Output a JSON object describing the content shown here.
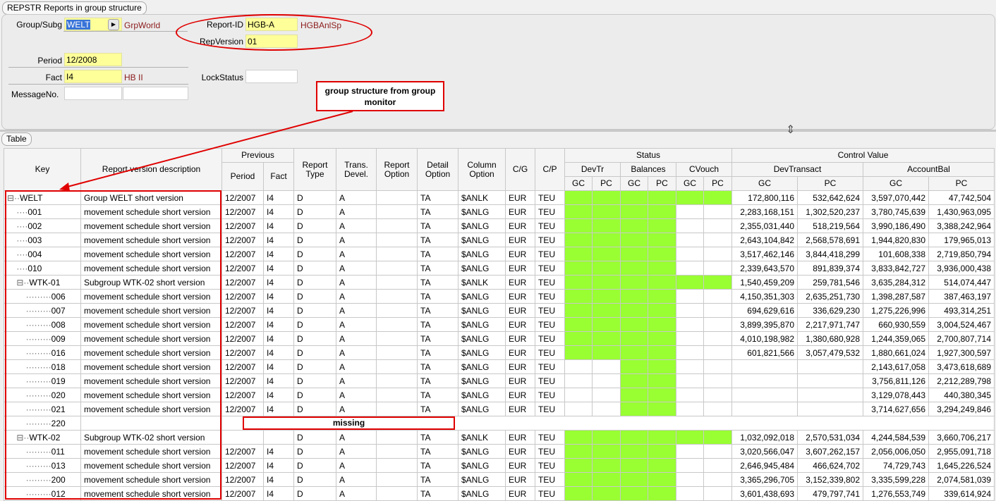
{
  "window": {
    "title": "REPSTR Reports in group structure"
  },
  "form": {
    "group_subg": {
      "label": "Group/Subg",
      "value": "WELT",
      "desc": "GrpWorld"
    },
    "report_id": {
      "label": "Report-ID",
      "value": "HGB-A",
      "desc": "HGBAnlSp"
    },
    "rep_version": {
      "label": "RepVersion",
      "value": "01"
    },
    "period": {
      "label": "Period",
      "value": "12/2008"
    },
    "fact": {
      "label": "Fact",
      "value": "I4",
      "desc": "HB II"
    },
    "lock_status": {
      "label": "LockStatus",
      "value": ""
    },
    "message_no": {
      "label": "MessageNo.",
      "value": ""
    }
  },
  "table_tab": "Table",
  "annotations": {
    "callout": "group structure from group monitor",
    "missing": "missing"
  },
  "headers": {
    "key": "Key",
    "desc": "Report version description",
    "previous": "Previous",
    "period": "Period",
    "fact": "Fact",
    "report_type": "Report Type",
    "trans_devel": "Trans. Devel.",
    "report_option": "Report Option",
    "detail_option": "Detail Option",
    "column_option": "Column Option",
    "cg": "C/G",
    "cp": "C/P",
    "status": "Status",
    "devtr": "DevTr",
    "balances": "Balances",
    "cvouch": "CVouch",
    "control_value": "Control Value",
    "devtransact": "DevTransact",
    "accountbal": "AccountBal",
    "gc": "GC",
    "pc": "PC"
  },
  "rows": [
    {
      "key": "WELT",
      "prefix": "⊟··",
      "desc": "Group WELT short version",
      "period": "12/2007",
      "fact": "I4",
      "rtype": "D",
      "trans": "A",
      "ropt": "",
      "detail": "TA",
      "col": "$ANLK",
      "cg": "EUR",
      "cp": "TEU",
      "st": [
        1,
        1,
        1,
        1,
        1,
        1
      ],
      "dt_gc": "172,800,116",
      "dt_pc": "532,642,624",
      "ab_gc": "3,597,070,442",
      "ab_pc": "47,742,504"
    },
    {
      "key": "001",
      "prefix": "    ····",
      "desc": "movement schedule short version",
      "period": "12/2007",
      "fact": "I4",
      "rtype": "D",
      "trans": "A",
      "ropt": "",
      "detail": "TA",
      "col": "$ANLG",
      "cg": "EUR",
      "cp": "TEU",
      "st": [
        1,
        1,
        1,
        1,
        0,
        0
      ],
      "dt_gc": "2,283,168,151",
      "dt_pc": "1,302,520,237",
      "ab_gc": "3,780,745,639",
      "ab_pc": "1,430,963,095"
    },
    {
      "key": "002",
      "prefix": "    ····",
      "desc": "movement schedule short version",
      "period": "12/2007",
      "fact": "I4",
      "rtype": "D",
      "trans": "A",
      "ropt": "",
      "detail": "TA",
      "col": "$ANLG",
      "cg": "EUR",
      "cp": "TEU",
      "st": [
        1,
        1,
        1,
        1,
        0,
        0
      ],
      "dt_gc": "2,355,031,440",
      "dt_pc": "518,219,564",
      "ab_gc": "3,990,186,490",
      "ab_pc": "3,388,242,964"
    },
    {
      "key": "003",
      "prefix": "    ····",
      "desc": "movement schedule short version",
      "period": "12/2007",
      "fact": "I4",
      "rtype": "D",
      "trans": "A",
      "ropt": "",
      "detail": "TA",
      "col": "$ANLG",
      "cg": "EUR",
      "cp": "TEU",
      "st": [
        1,
        1,
        1,
        1,
        0,
        0
      ],
      "dt_gc": "2,643,104,842",
      "dt_pc": "2,568,578,691",
      "ab_gc": "1,944,820,830",
      "ab_pc": "179,965,013"
    },
    {
      "key": "004",
      "prefix": "    ····",
      "desc": "movement schedule short version",
      "period": "12/2007",
      "fact": "I4",
      "rtype": "D",
      "trans": "A",
      "ropt": "",
      "detail": "TA",
      "col": "$ANLG",
      "cg": "EUR",
      "cp": "TEU",
      "st": [
        1,
        1,
        1,
        1,
        0,
        0
      ],
      "dt_gc": "3,517,462,146",
      "dt_pc": "3,844,418,299",
      "ab_gc": "101,608,338",
      "ab_pc": "2,719,850,794"
    },
    {
      "key": "010",
      "prefix": "    ····",
      "desc": "movement schedule short version",
      "period": "12/2007",
      "fact": "I4",
      "rtype": "D",
      "trans": "A",
      "ropt": "",
      "detail": "TA",
      "col": "$ANLG",
      "cg": "EUR",
      "cp": "TEU",
      "st": [
        1,
        1,
        1,
        1,
        0,
        0
      ],
      "dt_gc": "2,339,643,570",
      "dt_pc": "891,839,374",
      "ab_gc": "3,833,842,727",
      "ab_pc": "3,936,000,438"
    },
    {
      "key": "WTK-01",
      "prefix": "    ⊟··",
      "desc": "Subgroup WTK-02 short version",
      "period": "12/2007",
      "fact": "I4",
      "rtype": "D",
      "trans": "A",
      "ropt": "",
      "detail": "TA",
      "col": "$ANLK",
      "cg": "EUR",
      "cp": "TEU",
      "st": [
        1,
        1,
        1,
        1,
        1,
        1
      ],
      "dt_gc": "1,540,459,209",
      "dt_pc": "259,781,546",
      "ab_gc": "3,635,284,312",
      "ab_pc": "514,074,447"
    },
    {
      "key": "006",
      "prefix": "        ·········",
      "desc": "movement schedule short version",
      "period": "12/2007",
      "fact": "I4",
      "rtype": "D",
      "trans": "A",
      "ropt": "",
      "detail": "TA",
      "col": "$ANLG",
      "cg": "EUR",
      "cp": "TEU",
      "st": [
        1,
        1,
        1,
        1,
        0,
        0
      ],
      "dt_gc": "4,150,351,303",
      "dt_pc": "2,635,251,730",
      "ab_gc": "1,398,287,587",
      "ab_pc": "387,463,197"
    },
    {
      "key": "007",
      "prefix": "        ·········",
      "desc": "movement schedule short version",
      "period": "12/2007",
      "fact": "I4",
      "rtype": "D",
      "trans": "A",
      "ropt": "",
      "detail": "TA",
      "col": "$ANLG",
      "cg": "EUR",
      "cp": "TEU",
      "st": [
        1,
        1,
        1,
        1,
        0,
        0
      ],
      "dt_gc": "694,629,616",
      "dt_pc": "336,629,230",
      "ab_gc": "1,275,226,996",
      "ab_pc": "493,314,251"
    },
    {
      "key": "008",
      "prefix": "        ·········",
      "desc": "movement schedule short version",
      "period": "12/2007",
      "fact": "I4",
      "rtype": "D",
      "trans": "A",
      "ropt": "",
      "detail": "TA",
      "col": "$ANLG",
      "cg": "EUR",
      "cp": "TEU",
      "st": [
        1,
        1,
        1,
        1,
        0,
        0
      ],
      "dt_gc": "3,899,395,870",
      "dt_pc": "2,217,971,747",
      "ab_gc": "660,930,559",
      "ab_pc": "3,004,524,467"
    },
    {
      "key": "009",
      "prefix": "        ·········",
      "desc": "movement schedule short version",
      "period": "12/2007",
      "fact": "I4",
      "rtype": "D",
      "trans": "A",
      "ropt": "",
      "detail": "TA",
      "col": "$ANLG",
      "cg": "EUR",
      "cp": "TEU",
      "st": [
        1,
        1,
        1,
        1,
        0,
        0
      ],
      "dt_gc": "4,010,198,982",
      "dt_pc": "1,380,680,928",
      "ab_gc": "1,244,359,065",
      "ab_pc": "2,700,807,714"
    },
    {
      "key": "016",
      "prefix": "        ·········",
      "desc": "movement schedule short version",
      "period": "12/2007",
      "fact": "I4",
      "rtype": "D",
      "trans": "A",
      "ropt": "",
      "detail": "TA",
      "col": "$ANLG",
      "cg": "EUR",
      "cp": "TEU",
      "st": [
        1,
        1,
        1,
        1,
        0,
        0
      ],
      "dt_gc": "601,821,566",
      "dt_pc": "3,057,479,532",
      "ab_gc": "1,880,661,024",
      "ab_pc": "1,927,300,597"
    },
    {
      "key": "018",
      "prefix": "        ·········",
      "desc": "movement schedule short version",
      "period": "12/2007",
      "fact": "I4",
      "rtype": "D",
      "trans": "A",
      "ropt": "",
      "detail": "TA",
      "col": "$ANLG",
      "cg": "EUR",
      "cp": "TEU",
      "st": [
        0,
        0,
        1,
        1,
        0,
        0
      ],
      "dt_gc": "",
      "dt_pc": "",
      "ab_gc": "2,143,617,058",
      "ab_pc": "3,473,618,689"
    },
    {
      "key": "019",
      "prefix": "        ·········",
      "desc": "movement schedule short version",
      "period": "12/2007",
      "fact": "I4",
      "rtype": "D",
      "trans": "A",
      "ropt": "",
      "detail": "TA",
      "col": "$ANLG",
      "cg": "EUR",
      "cp": "TEU",
      "st": [
        0,
        0,
        1,
        1,
        0,
        0
      ],
      "dt_gc": "",
      "dt_pc": "",
      "ab_gc": "3,756,811,126",
      "ab_pc": "2,212,289,798"
    },
    {
      "key": "020",
      "prefix": "        ·········",
      "desc": "movement schedule short version",
      "period": "12/2007",
      "fact": "I4",
      "rtype": "D",
      "trans": "A",
      "ropt": "",
      "detail": "TA",
      "col": "$ANLG",
      "cg": "EUR",
      "cp": "TEU",
      "st": [
        0,
        0,
        1,
        1,
        0,
        0
      ],
      "dt_gc": "",
      "dt_pc": "",
      "ab_gc": "3,129,078,443",
      "ab_pc": "440,380,345"
    },
    {
      "key": "021",
      "prefix": "        ·········",
      "desc": "movement schedule short version",
      "period": "12/2007",
      "fact": "I4",
      "rtype": "D",
      "trans": "A",
      "ropt": "",
      "detail": "TA",
      "col": "$ANLG",
      "cg": "EUR",
      "cp": "TEU",
      "st": [
        0,
        0,
        1,
        1,
        0,
        0
      ],
      "dt_gc": "",
      "dt_pc": "",
      "ab_gc": "3,714,627,656",
      "ab_pc": "3,294,249,846"
    },
    {
      "key": "220",
      "prefix": "        ·········",
      "missing": true
    },
    {
      "key": "WTK-02",
      "prefix": "    ⊟··",
      "desc": "Subgroup WTK-02 short version",
      "period": "",
      "fact": "",
      "rtype": "D",
      "trans": "A",
      "ropt": "",
      "detail": "TA",
      "col": "$ANLK",
      "cg": "EUR",
      "cp": "TEU",
      "st": [
        1,
        1,
        1,
        1,
        1,
        1
      ],
      "dt_gc": "1,032,092,018",
      "dt_pc": "2,570,531,034",
      "ab_gc": "4,244,584,539",
      "ab_pc": "3,660,706,217"
    },
    {
      "key": "011",
      "prefix": "        ·········",
      "desc": "movement schedule short version",
      "period": "12/2007",
      "fact": "I4",
      "rtype": "D",
      "trans": "A",
      "ropt": "",
      "detail": "TA",
      "col": "$ANLG",
      "cg": "EUR",
      "cp": "TEU",
      "st": [
        1,
        1,
        1,
        1,
        0,
        0
      ],
      "dt_gc": "3,020,566,047",
      "dt_pc": "3,607,262,157",
      "ab_gc": "2,056,006,050",
      "ab_pc": "2,955,091,718"
    },
    {
      "key": "013",
      "prefix": "        ·········",
      "desc": "movement schedule short version",
      "period": "12/2007",
      "fact": "I4",
      "rtype": "D",
      "trans": "A",
      "ropt": "",
      "detail": "TA",
      "col": "$ANLG",
      "cg": "EUR",
      "cp": "TEU",
      "st": [
        1,
        1,
        1,
        1,
        0,
        0
      ],
      "dt_gc": "2,646,945,484",
      "dt_pc": "466,624,702",
      "ab_gc": "74,729,743",
      "ab_pc": "1,645,226,524"
    },
    {
      "key": "200",
      "prefix": "        ·········",
      "desc": "movement schedule short version",
      "period": "12/2007",
      "fact": "I4",
      "rtype": "D",
      "trans": "A",
      "ropt": "",
      "detail": "TA",
      "col": "$ANLG",
      "cg": "EUR",
      "cp": "TEU",
      "st": [
        1,
        1,
        1,
        1,
        0,
        0
      ],
      "dt_gc": "3,365,296,705",
      "dt_pc": "3,152,339,802",
      "ab_gc": "3,335,599,228",
      "ab_pc": "2,074,581,039"
    },
    {
      "key": "012",
      "prefix": "        ·········",
      "desc": "movement schedule short version",
      "period": "12/2007",
      "fact": "I4",
      "rtype": "D",
      "trans": "A",
      "ropt": "",
      "detail": "TA",
      "col": "$ANLG",
      "cg": "EUR",
      "cp": "TEU",
      "st": [
        1,
        1,
        1,
        1,
        0,
        0
      ],
      "dt_gc": "3,601,438,693",
      "dt_pc": "479,797,741",
      "ab_gc": "1,276,553,749",
      "ab_pc": "339,614,924"
    }
  ],
  "colors": {
    "status_ok": "#99ff33",
    "field_required": "#ffff99",
    "annotation": "#e00000"
  }
}
